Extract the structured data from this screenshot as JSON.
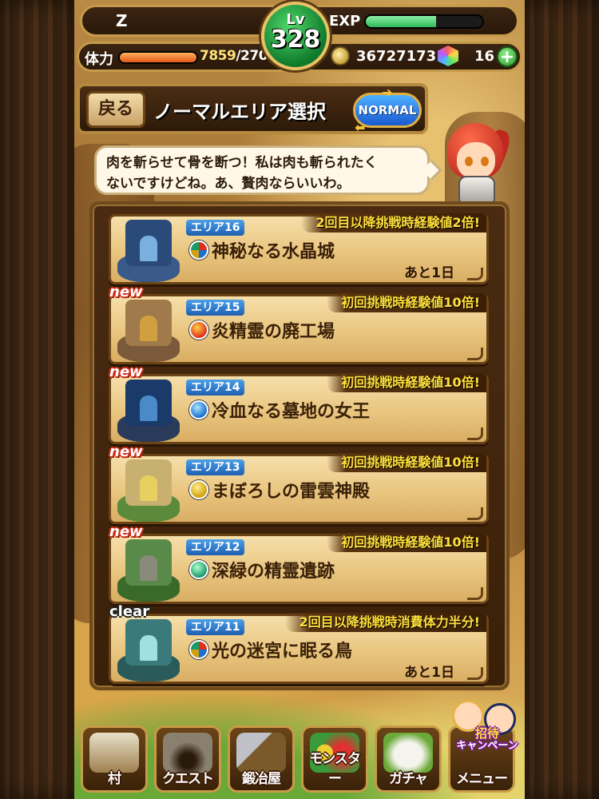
{
  "header": {
    "player_name": "Z",
    "level_label": "Lv",
    "level": "328",
    "exp_label": "EXP",
    "exp_progress": 0.6,
    "stamina_label": "体力",
    "stamina_current": "7859",
    "stamina_max": "/270",
    "stamina_progress": 1.0,
    "coins": "36727173",
    "gems": "16",
    "plus_label": "+"
  },
  "title_bar": {
    "back_label": "戻る",
    "title": "ノーマルエリア選択",
    "mode_label": "NORMAL"
  },
  "speech": {
    "line1": "肉を斬らせて骨を断つ！私は肉も斬られたく",
    "line2": "ないですけどね。あ、贅肉ならいいわ。"
  },
  "areas": [
    {
      "tag": "エリア16",
      "name": "神秘なる水晶城",
      "bonus": "2回目以降挑戦時経験値2倍!",
      "remaining": "あと1日",
      "badge": "",
      "element": "mixed",
      "theme": "blue"
    },
    {
      "tag": "エリア15",
      "name": "炎精霊の廃工場",
      "bonus": "初回挑戦時経験値10倍!",
      "remaining": "",
      "badge": "new",
      "element": "fire",
      "theme": "brown"
    },
    {
      "tag": "エリア14",
      "name": "冷血なる墓地の女王",
      "bonus": "初回挑戦時経験値10倍!",
      "remaining": "",
      "badge": "new",
      "element": "water",
      "theme": "navy"
    },
    {
      "tag": "エリア13",
      "name": "まぼろしの雷雲神殿",
      "bonus": "初回挑戦時経験値10倍!",
      "remaining": "",
      "badge": "new",
      "element": "thunder",
      "theme": "green-gold"
    },
    {
      "tag": "エリア12",
      "name": "深緑の精霊遺跡",
      "bonus": "初回挑戦時経験値10倍!",
      "remaining": "",
      "badge": "new",
      "element": "wind",
      "theme": "forest"
    },
    {
      "tag": "エリア11",
      "name": "光の迷宮に眠る鳥",
      "bonus": "2回目以降挑戦時消費体力半分!",
      "remaining": "あと1日",
      "badge": "clear",
      "element": "mixed",
      "theme": "teal"
    }
  ],
  "bottom_nav": [
    {
      "label": "村",
      "icon": "village-gate-icon"
    },
    {
      "label": "クエスト",
      "icon": "cave-icon"
    },
    {
      "label": "鍛冶屋",
      "icon": "hammer-icon"
    },
    {
      "label": "モンスター",
      "icon": "monsters-icon"
    },
    {
      "label": "ガチャ",
      "icon": "egg-icon"
    },
    {
      "label": "メニュー",
      "icon": "menu-icon"
    }
  ],
  "invite": {
    "line1": "招待",
    "line2": "キャンペーン"
  },
  "colors": {
    "exp_bar": "#2fb85a",
    "stamina_bar": "#e2571a",
    "bonus_text": "#ffe03a",
    "area_tag": "#1f5fb0",
    "card_bg": "#e9c57f"
  }
}
